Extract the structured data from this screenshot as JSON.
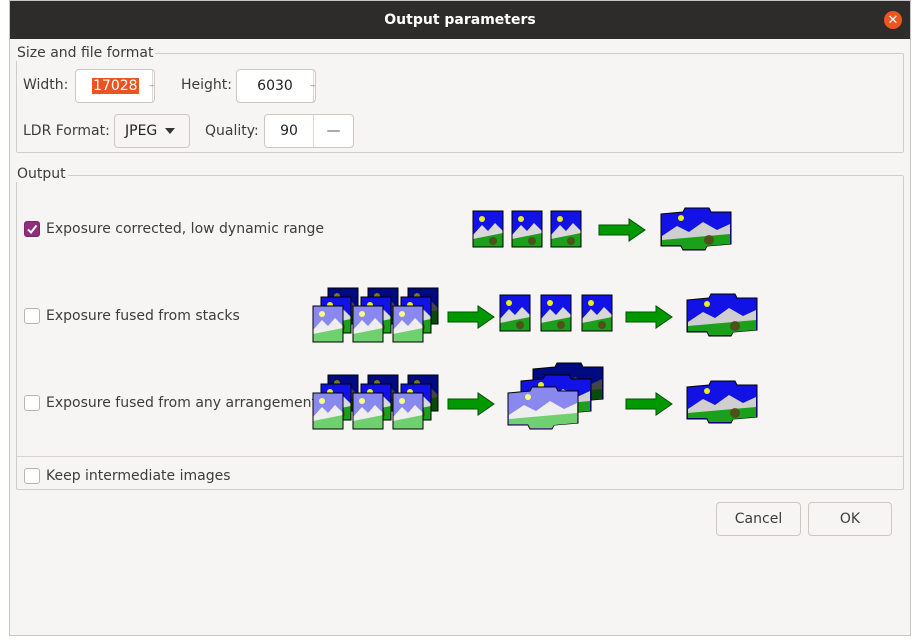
{
  "window": {
    "title": "Output parameters",
    "close_icon": "close-icon"
  },
  "size_group": {
    "title": "Size and file format",
    "width_label": "Width:",
    "width_value": "17028",
    "height_label": "Height:",
    "height_value": "6030",
    "ldr_format_label": "LDR Format:",
    "ldr_format_value": "JPEG",
    "quality_label": "Quality:",
    "quality_value": "90",
    "decrement_glyph": "—"
  },
  "output_group": {
    "title": "Output",
    "options": [
      {
        "label": "Exposure corrected, low dynamic range",
        "checked": true
      },
      {
        "label": "Exposure fused from stacks",
        "checked": false
      },
      {
        "label": "Exposure fused from any arrangement",
        "checked": false
      }
    ],
    "keep_intermediate": {
      "label": "Keep intermediate images",
      "checked": false
    }
  },
  "buttons": {
    "cancel": "Cancel",
    "ok": "OK"
  },
  "colors": {
    "accent": "#e95420",
    "check": "#8e2e7d",
    "arrow": "#00a000",
    "sky": "#1010e0",
    "night_sky": "#000a80",
    "grass": "#1aa01a"
  }
}
